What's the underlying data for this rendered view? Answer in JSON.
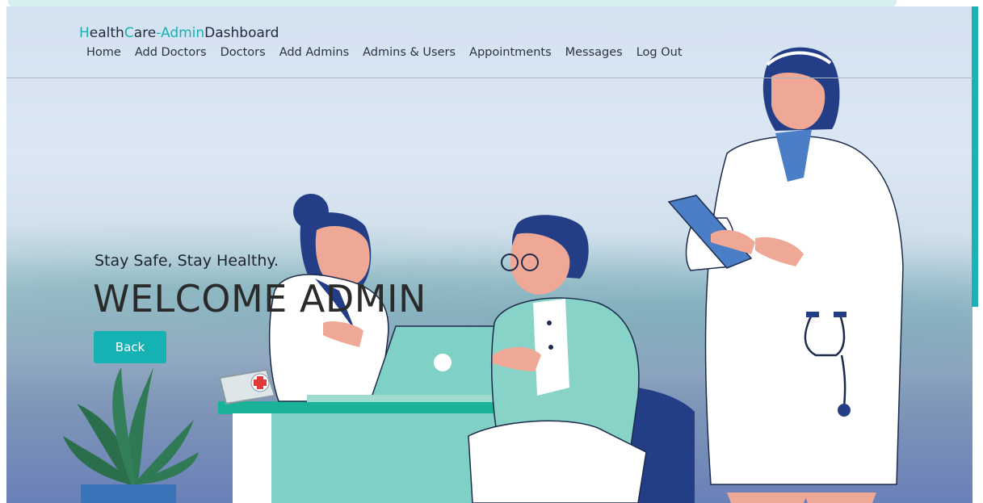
{
  "brand": {
    "parts": [
      "H",
      "ealth",
      "C",
      "are",
      "-",
      "Admin",
      "Dashboard"
    ]
  },
  "nav": {
    "items": [
      "Home",
      "Add Doctors",
      "Doctors",
      "Add Admins",
      "Admins & Users",
      "Appointments",
      "Messages",
      "Log Out"
    ]
  },
  "hero": {
    "tagline": "Stay Safe, Stay Healthy.",
    "title": "WELCOME ADMIN",
    "back_label": "Back"
  },
  "colors": {
    "accent": "#17b0b4",
    "text": "#2a3342"
  },
  "icons": [
    "plant-icon",
    "laptop-icon",
    "medical-kit-icon",
    "stethoscope-icon",
    "clipboard-icon"
  ]
}
